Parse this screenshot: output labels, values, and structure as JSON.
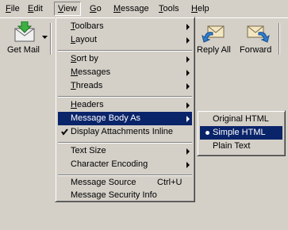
{
  "menubar": [
    "File",
    "Edit",
    "View",
    "Go",
    "Message",
    "Tools",
    "Help"
  ],
  "menubar_underline": [
    "F",
    "E",
    "V",
    "G",
    "M",
    "T",
    "H"
  ],
  "toolbar": {
    "get_mail": "Get Mail",
    "reply_all": "Reply All",
    "forward": "Forward"
  },
  "view_menu": {
    "toolbars": "Toolbars",
    "layout": "Layout",
    "sort_by": "Sort by",
    "messages": "Messages",
    "threads": "Threads",
    "headers": "Headers",
    "message_body_as": "Message Body As",
    "display_attachments_inline": "Display Attachments Inline",
    "text_size": "Text Size",
    "character_encoding": "Character Encoding",
    "message_source": "Message Source",
    "message_source_shortcut": "Ctrl+U",
    "message_security_info": "Message Security Info"
  },
  "body_as_menu": {
    "original_html": "Original HTML",
    "simple_html": "Simple HTML",
    "plain_text": "Plain Text"
  },
  "colors": {
    "menu_face": "#d4d0c8",
    "highlight": "#0a246a"
  }
}
